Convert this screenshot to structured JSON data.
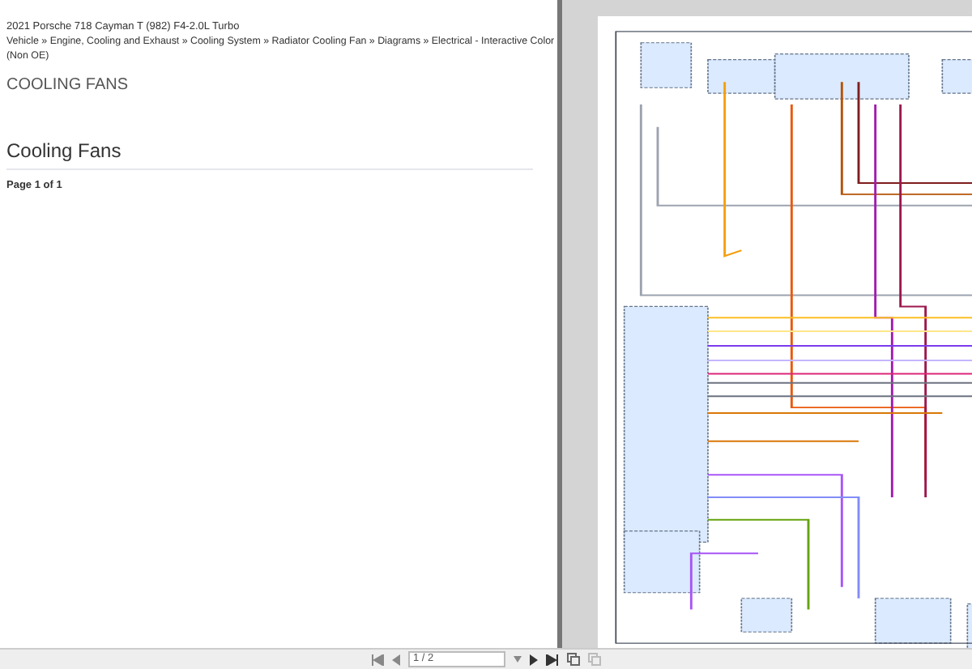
{
  "document": {
    "vehicle": "2021 Porsche 718 Cayman T (982) F4-2.0L Turbo",
    "breadcrumb": "Vehicle » Engine, Cooling and Exhaust » Cooling System » Radiator Cooling Fan » Diagrams » Electrical - Interactive Color (Non OE)",
    "title": "COOLING FANS",
    "section": "Cooling Fans",
    "page_label": "Page 1 of 1"
  },
  "viewer": {
    "page_field": "1 / 2"
  }
}
